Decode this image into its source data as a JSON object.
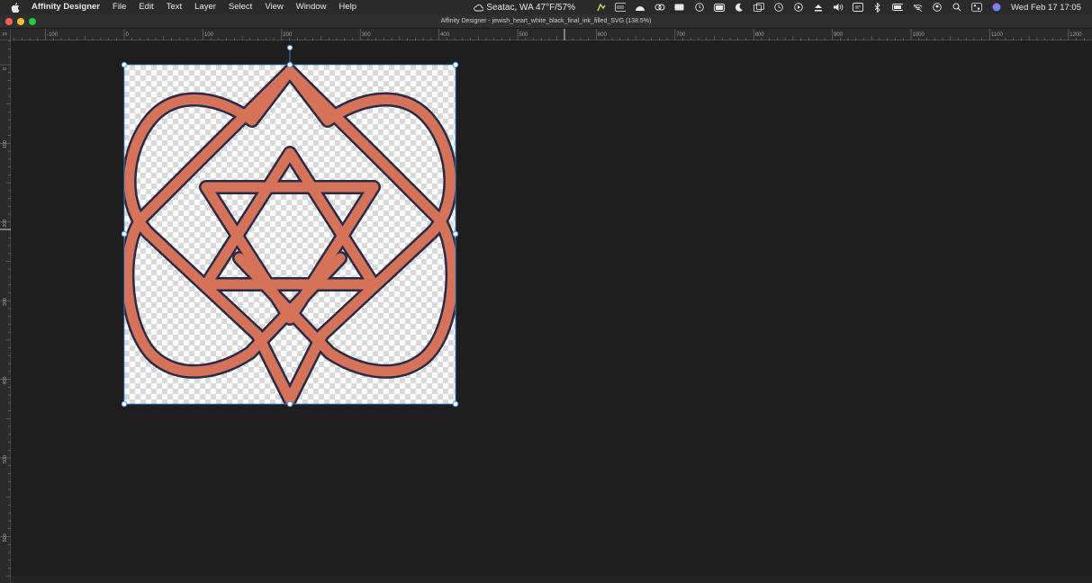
{
  "menubar": {
    "app_name": "Affinity Designer",
    "items": [
      "File",
      "Edit",
      "Text",
      "Layer",
      "Select",
      "View",
      "Window",
      "Help"
    ],
    "weather": "Seatac, WA 47°F/57%",
    "datetime": "Wed Feb 17  17:05",
    "status_icons": [
      "extension-icon",
      "keyboard-icon",
      "arc-icon",
      "creative-cloud-icon",
      "battery-status-icon",
      "clock-icon",
      "memory-icon",
      "moon-icon",
      "window-icon",
      "time-machine-icon",
      "play-icon",
      "eject-icon",
      "volume-icon",
      "display-icon",
      "bluetooth-icon",
      "battery-icon",
      "wifi-icon",
      "user-icon",
      "spotlight-icon",
      "control-center-icon",
      "siri-icon"
    ]
  },
  "window": {
    "title": "Affinity Designer - jewish_heart_white_black_final_ink_filled_SVG (138.5%)"
  },
  "ruler": {
    "unit": "px",
    "h_labels": [
      "-100",
      "0",
      "100",
      "200",
      "300",
      "400",
      "500",
      "600",
      "700",
      "800",
      "900",
      "1000",
      "1100",
      "1200"
    ],
    "v_labels": [
      "0",
      "100",
      "200",
      "300",
      "400",
      "500",
      "600"
    ]
  },
  "artwork": {
    "fill_color": "#d4735a",
    "stroke_color": "#2b2a45",
    "description_icon": "star-of-david-heart-knot"
  },
  "selection": {
    "handle_color": "#4a90e2"
  }
}
